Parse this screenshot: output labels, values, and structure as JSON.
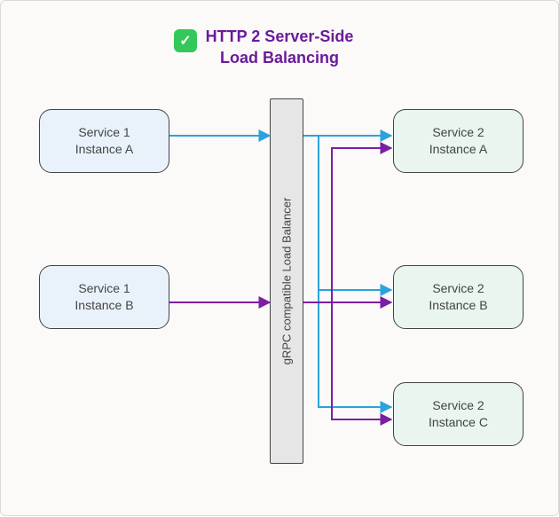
{
  "title": {
    "line1": "HTTP 2 Server-Side",
    "line2": "Load Balancing"
  },
  "left": [
    {
      "service": "Service 1",
      "instance": "Instance A"
    },
    {
      "service": "Service 1",
      "instance": "Instance B"
    }
  ],
  "right": [
    {
      "service": "Service 2",
      "instance": "Instance A"
    },
    {
      "service": "Service 2",
      "instance": "Instance B"
    },
    {
      "service": "Service 2",
      "instance": "Instance C"
    }
  ],
  "balancer": {
    "label": "gRPC compatible Load Balancer"
  },
  "colors": {
    "blue": "#2aa3dd",
    "purple": "#7b1fa2",
    "border": "#444",
    "title": "#6a1b9a"
  },
  "chart_data": {
    "type": "flow",
    "title": "HTTP 2 Server-Side Load Balancing",
    "clients": [
      "Service 1 Instance A",
      "Service 1 Instance B"
    ],
    "balancer": "gRPC compatible Load Balancer",
    "servers": [
      "Service 2 Instance A",
      "Service 2 Instance B",
      "Service 2 Instance C"
    ],
    "edges": [
      {
        "from": "Service 1 Instance A",
        "via": "balancer",
        "to": [
          "Service 2 Instance A",
          "Service 2 Instance B",
          "Service 2 Instance C"
        ],
        "color": "blue"
      },
      {
        "from": "Service 1 Instance B",
        "via": "balancer",
        "to": [
          "Service 2 Instance A",
          "Service 2 Instance B",
          "Service 2 Instance C"
        ],
        "color": "purple"
      }
    ]
  }
}
